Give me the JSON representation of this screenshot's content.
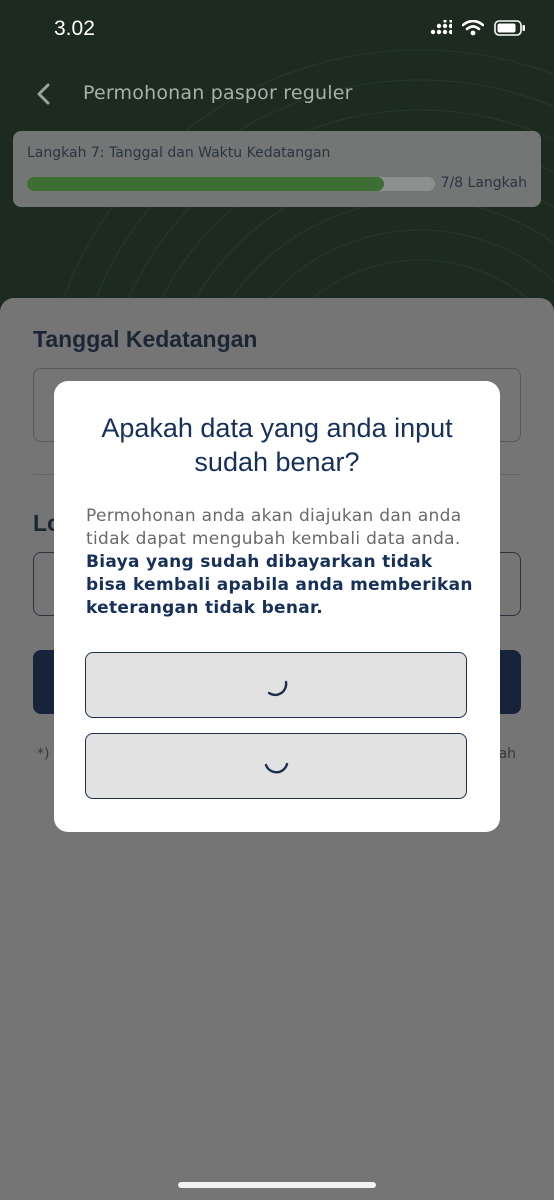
{
  "status_bar": {
    "time": "3.02",
    "icons": [
      "signal-icon",
      "wifi-icon",
      "battery-icon"
    ]
  },
  "header": {
    "title": "Permohonan paspor reguler",
    "back_icon": "chevron-left-icon"
  },
  "step": {
    "label": "Langkah 7: Tanggal dan Waktu Kedatangan",
    "count": "7/8 Langkah",
    "progress": 0.875
  },
  "form": {
    "date_section_title": "Tanggal Kedatangan",
    "location_section_title": "Lo",
    "note_start": "*)",
    "note_end": "ah"
  },
  "modal": {
    "title": "Apakah data yang anda input sudah benar?",
    "body_normal": "Permohonan anda akan diajukan dan anda tidak dapat mengubah kembali data anda.",
    "body_bold": "Biaya yang sudah dibayarkan tidak bisa kembali apabila anda memberikan keterangan tidak benar.",
    "buttons": [
      {
        "state": "loading",
        "icon": "spinner-icon"
      },
      {
        "state": "loading",
        "icon": "spinner-icon"
      }
    ]
  },
  "colors": {
    "accent_navy": "#16305a",
    "progress_green": "#3d6e34",
    "overlay": "#757575"
  }
}
